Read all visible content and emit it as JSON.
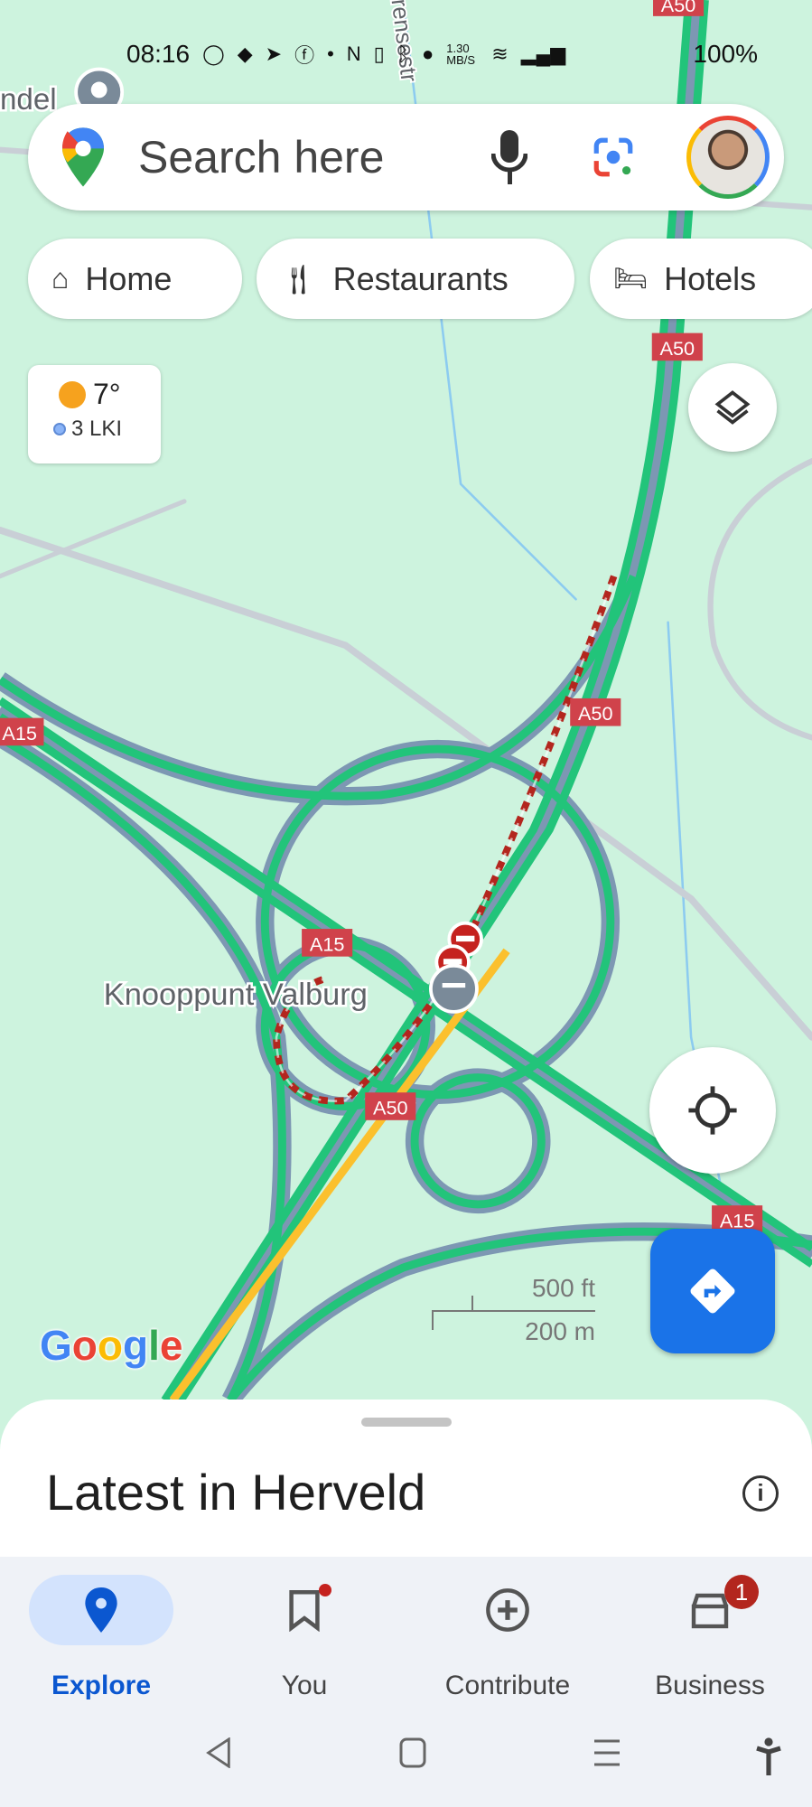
{
  "status_bar": {
    "time": "08:16",
    "net_speed": "1.30 MB/S",
    "battery": "100%",
    "icons": [
      "whatsapp-icon",
      "discord-icon",
      "telegram-icon",
      "facebook-icon",
      "dot-icon",
      "nfc-icon",
      "vibrate-icon",
      "bluetooth-icon",
      "location-icon",
      "wifi-icon",
      "signal-icon"
    ]
  },
  "search": {
    "placeholder": "Search here"
  },
  "chips": [
    {
      "label": "Home",
      "icon": "home-icon"
    },
    {
      "label": "Restaurants",
      "icon": "restaurant-icon"
    },
    {
      "label": "Hotels",
      "icon": "hotel-icon"
    }
  ],
  "weather": {
    "temp": "7°",
    "aqi": "3 LKI"
  },
  "map": {
    "place_label": "Knooppunt Valburg",
    "street_label": "rensestr",
    "poi_label": "ndel",
    "road_shields": [
      "A50",
      "A50",
      "A50",
      "A50",
      "A15",
      "A15",
      "A15"
    ],
    "scale": {
      "imperial": "500 ft",
      "metric": "200 m"
    },
    "logo": "Google",
    "colors": {
      "background": "#cdf3de",
      "road": "#22c47a",
      "closure": "#b3261e",
      "slow": "#fbc02d"
    }
  },
  "sheet": {
    "title": "Latest in Herveld"
  },
  "nav": {
    "items": [
      {
        "label": "Explore",
        "active": true
      },
      {
        "label": "You",
        "dot": true
      },
      {
        "label": "Contribute"
      },
      {
        "label": "Business",
        "badge": "1"
      }
    ]
  },
  "accent": "#1a73e8"
}
